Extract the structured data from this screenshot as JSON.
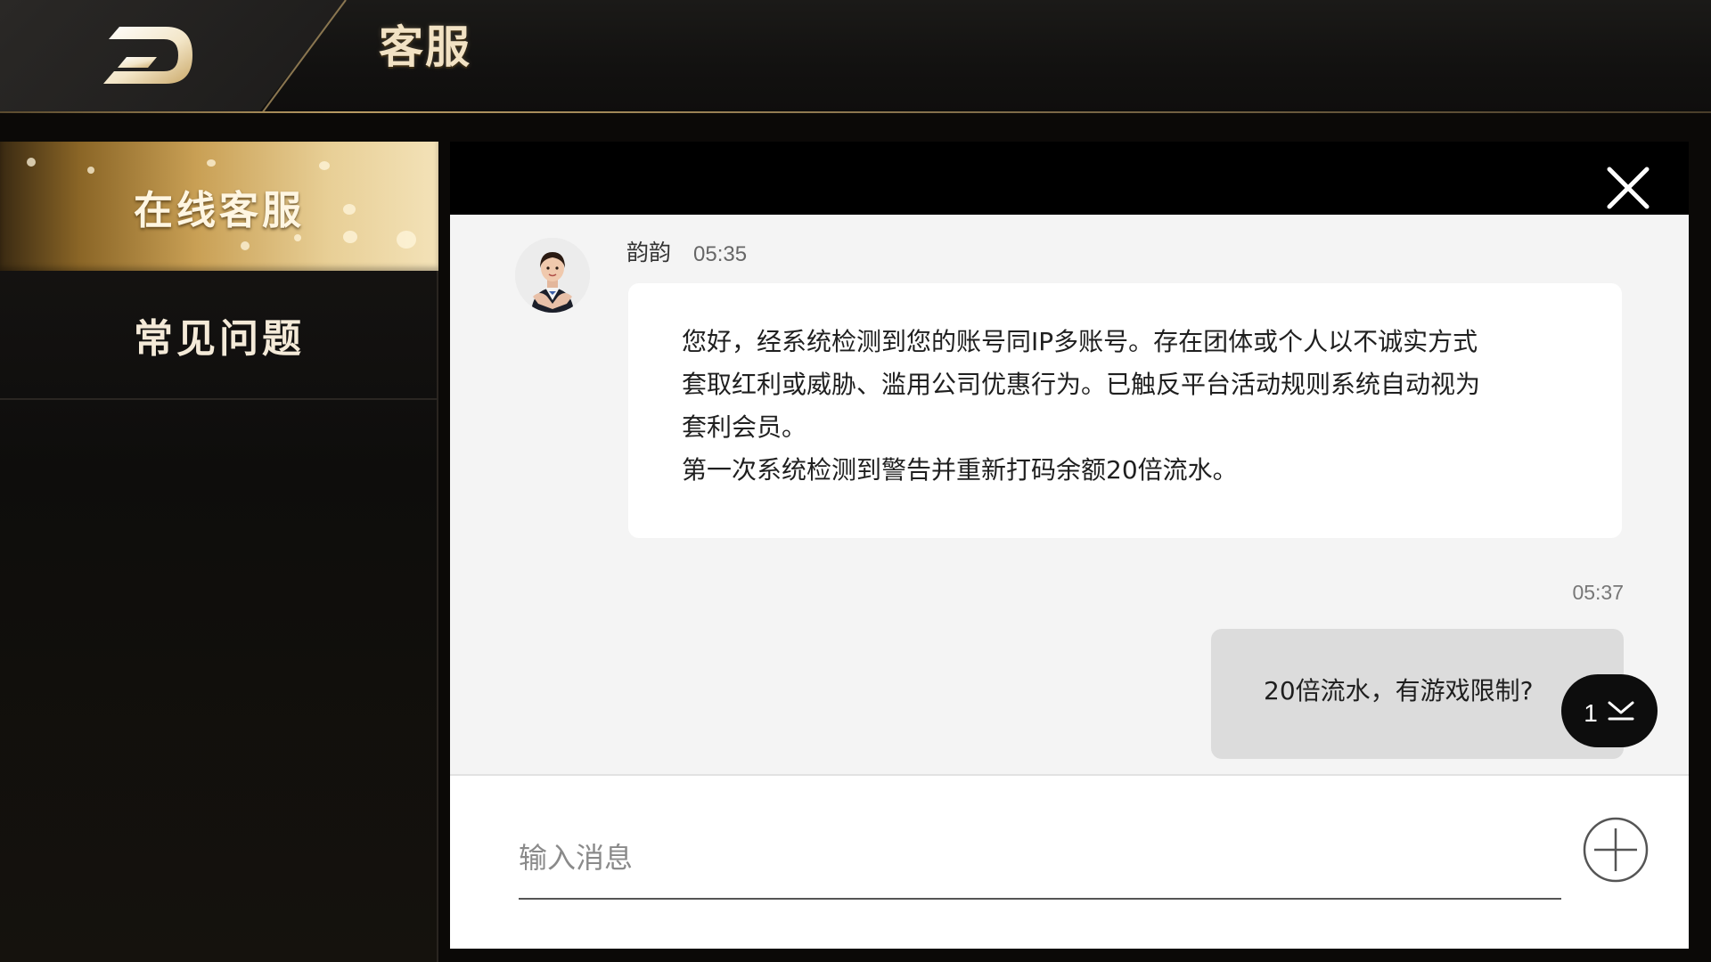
{
  "header": {
    "title": "客服"
  },
  "sidebar": {
    "items": [
      {
        "label": "在线客服"
      },
      {
        "label": "常见问题"
      }
    ]
  },
  "chat": {
    "agent": {
      "name": "韵韵",
      "time": "05:35",
      "message_lines": [
        "您好，经系统检测到您的账号同IP多账号。存在团体或个人以不诚实方式",
        "套取红利或威胁、滥用公司优惠行为。已触反平台活动规则系统自动视为",
        "套利会员。",
        "第一次系统检测到警告并重新打码余额20倍流水。"
      ]
    },
    "reply": {
      "time": "05:37",
      "text": "20倍流水，有游戏限制?"
    },
    "new_message_count": "1"
  },
  "composer": {
    "placeholder": "输入消息"
  },
  "icons": {
    "back": "back-icon",
    "close": "close-icon",
    "scroll_down": "chevron-down-icon",
    "add": "plus-icon"
  },
  "colors": {
    "gold_accent": "#c9a055",
    "title_text": "#f2e2c4",
    "chat_bg": "#f4f4f4",
    "reply_bubble": "#dcdcdc"
  }
}
